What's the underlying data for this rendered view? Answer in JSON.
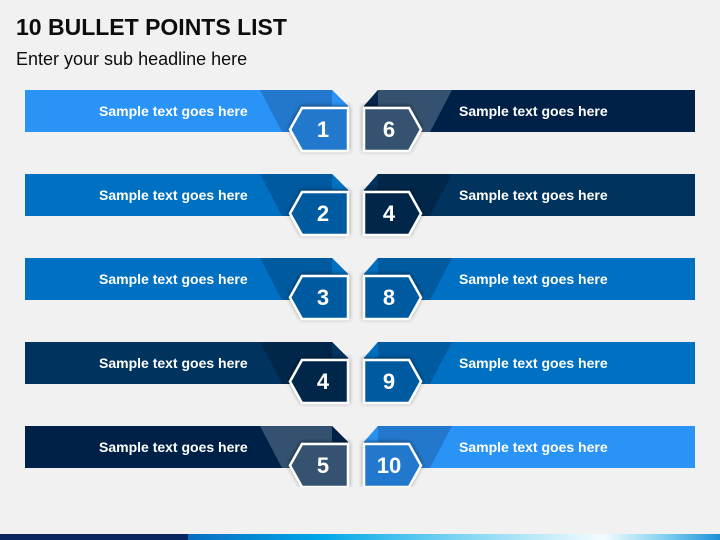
{
  "title": "10 BULLET POINTS LIST",
  "subtitle": "Enter your sub headline here",
  "left_items": [
    {
      "number": "1",
      "text": "Sample text goes here",
      "color": "#2994f6",
      "fold": "#2378cd",
      "badge": "#2378cd"
    },
    {
      "number": "2",
      "text": "Sample text goes here",
      "color": "#0071c2",
      "fold": "#005aa0",
      "badge": "#005aa0"
    },
    {
      "number": "3",
      "text": "Sample text goes here",
      "color": "#0071c2",
      "fold": "#005aa0",
      "badge": "#005aa0"
    },
    {
      "number": "4",
      "text": "Sample text goes here",
      "color": "#00345f",
      "fold": "#00274a",
      "badge": "#00274a"
    },
    {
      "number": "5",
      "text": "Sample text goes here",
      "color": "#002147",
      "fold": "#34526f",
      "badge": "#34526f"
    }
  ],
  "right_items": [
    {
      "number": "6",
      "text": "Sample text goes here",
      "color": "#002147",
      "fold": "#34526f",
      "badge": "#34526f"
    },
    {
      "number": "4",
      "text": "Sample text goes here",
      "color": "#00345f",
      "fold": "#00274a",
      "badge": "#00274a"
    },
    {
      "number": "8",
      "text": "Sample text goes here",
      "color": "#0071c2",
      "fold": "#005aa0",
      "badge": "#005aa0"
    },
    {
      "number": "9",
      "text": "Sample text goes here",
      "color": "#0071c2",
      "fold": "#005aa0",
      "badge": "#005aa0"
    },
    {
      "number": "10",
      "text": "Sample text goes here",
      "color": "#2994f6",
      "fold": "#2378cd",
      "badge": "#2378cd"
    }
  ],
  "colors": {
    "background": "#f1f1f1",
    "strip_dark": "#0a2660"
  }
}
